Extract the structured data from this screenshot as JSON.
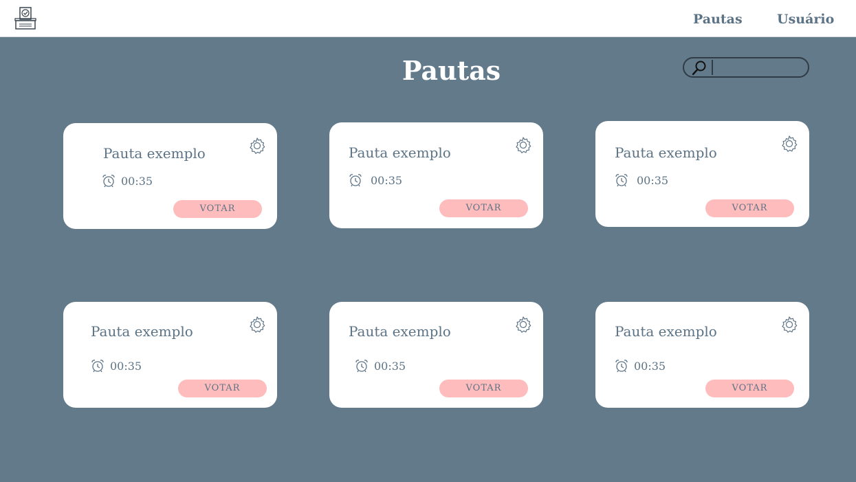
{
  "nav": {
    "pautas_label": "Pautas",
    "usuario_label": "Usuário"
  },
  "page": {
    "title": "Pautas"
  },
  "search": {
    "placeholder": ""
  },
  "cards": [
    {
      "title": "Pauta exemplo",
      "time": "00:35",
      "button_label": "VOTAR"
    },
    {
      "title": "Pauta exemplo",
      "time": "00:35",
      "button_label": "VOTAR"
    },
    {
      "title": "Pauta exemplo",
      "time": "00:35",
      "button_label": "VOTAR"
    },
    {
      "title": "Pauta exemplo",
      "time": "00:35",
      "button_label": "VOTAR"
    },
    {
      "title": "Pauta exemplo",
      "time": "00:35",
      "button_label": "VOTAR"
    },
    {
      "title": "Pauta exemplo",
      "time": "00:35",
      "button_label": "VOTAR"
    }
  ],
  "colors": {
    "background": "#637a8b",
    "card": "#ffffff",
    "text": "#5c7386",
    "button": "#ffbcbc"
  },
  "icons": [
    "ballot-box-icon",
    "search-icon",
    "gear-icon",
    "alarm-clock-icon"
  ]
}
